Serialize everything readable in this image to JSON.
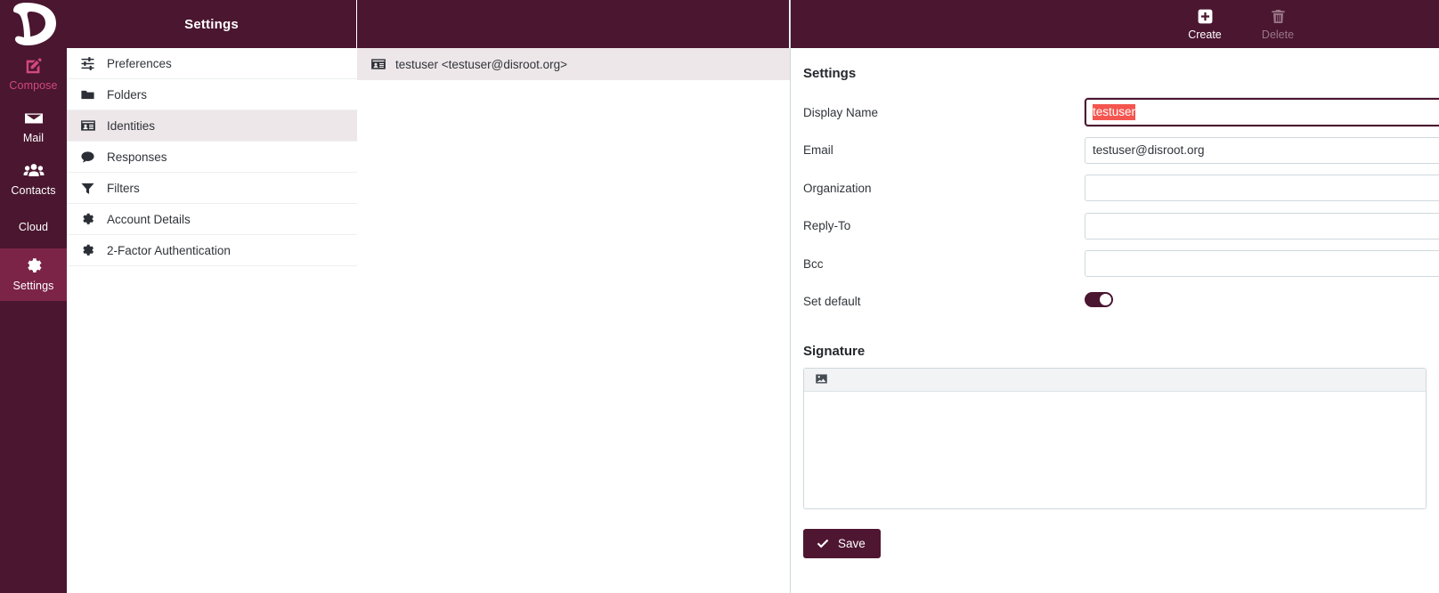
{
  "brand": {
    "logo_letter": "D",
    "accent_maroon": "#4a1630",
    "accent_maroon_active": "#7b2448",
    "accent_pink": "#d2487f",
    "selection_red": "#f4564f",
    "save_button_bg": "#4f1632",
    "row_selected_bg": "#ede7e9"
  },
  "rail": {
    "logo_name": "disroot-logo",
    "items": [
      {
        "label": "Compose",
        "icon": "compose-pencil-icon",
        "state": "accent"
      },
      {
        "label": "Mail",
        "icon": "envelope-icon",
        "state": "normal"
      },
      {
        "label": "Contacts",
        "icon": "contacts-people-icon",
        "state": "normal"
      },
      {
        "label": "Cloud",
        "icon": "none",
        "state": "normal"
      },
      {
        "label": "Settings",
        "icon": "gear-icon",
        "state": "active"
      }
    ]
  },
  "settings_panel": {
    "header_title": "Settings",
    "options": [
      {
        "label": "Preferences",
        "icon": "sliders-icon",
        "selected": false
      },
      {
        "label": "Folders",
        "icon": "folder-icon",
        "selected": false
      },
      {
        "label": "Identities",
        "icon": "id-card-icon",
        "selected": true
      },
      {
        "label": "Responses",
        "icon": "speech-bubble-icon",
        "selected": false
      },
      {
        "label": "Filters",
        "icon": "funnel-icon",
        "selected": false
      },
      {
        "label": "Account Details",
        "icon": "gear-icon",
        "selected": false
      },
      {
        "label": "2-Factor Authentication",
        "icon": "gear-icon",
        "selected": false
      }
    ]
  },
  "identity_list": {
    "header_title": "",
    "rows": [
      {
        "label": "testuser <testuser@disroot.org>",
        "icon": "id-card-icon",
        "selected": true
      }
    ]
  },
  "toolbar": {
    "create_label": "Create",
    "create_icon": "plus-square-icon",
    "delete_label": "Delete",
    "delete_icon": "trash-icon",
    "delete_disabled": true
  },
  "form": {
    "section_title": "Settings",
    "fields": [
      {
        "label": "Display Name",
        "value": "testuser",
        "placeholder": "",
        "focused": true,
        "selected_text": true
      },
      {
        "label": "Email",
        "value": "testuser@disroot.org",
        "placeholder": "",
        "focused": false,
        "selected_text": false
      },
      {
        "label": "Organization",
        "value": "",
        "placeholder": "",
        "focused": false,
        "selected_text": false
      },
      {
        "label": "Reply-To",
        "value": "",
        "placeholder": "",
        "focused": false,
        "selected_text": false
      },
      {
        "label": "Bcc",
        "value": "",
        "placeholder": "",
        "focused": false,
        "selected_text": false
      }
    ],
    "set_default": {
      "label": "Set default",
      "on": true
    }
  },
  "signature": {
    "section_title": "Signature",
    "toolbar": [
      {
        "icon": "insert-image-icon",
        "label": ""
      }
    ],
    "content": ""
  },
  "actions": {
    "save_label": "Save",
    "save_icon": "check-icon"
  }
}
